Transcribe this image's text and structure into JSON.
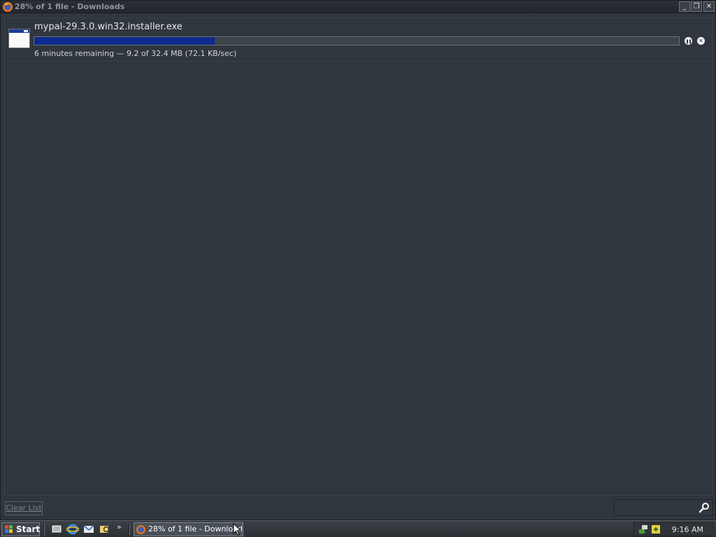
{
  "window": {
    "title": "28% of 1 file - Downloads",
    "controls": {
      "minimize": "_",
      "restore": "❐",
      "close": "✕"
    }
  },
  "downloads": [
    {
      "file_name": "mypal-29.3.0.win32.installer.exe",
      "progress": 0.28,
      "status": "6 minutes remaining — 9.2 of 32.4 MB (72.1 KB/sec)",
      "pause_glyph": "❚❚",
      "cancel_glyph": "✕"
    }
  ],
  "footer": {
    "clear_label": "Clear List",
    "search_placeholder": ""
  },
  "taskbar": {
    "start_label": "Start",
    "chevron": "»",
    "task_label": "28% of 1 file - Downloads",
    "clock": "9:16 AM"
  },
  "colors": {
    "progress_fill": "#0e2a8f",
    "background": "#30363d"
  }
}
